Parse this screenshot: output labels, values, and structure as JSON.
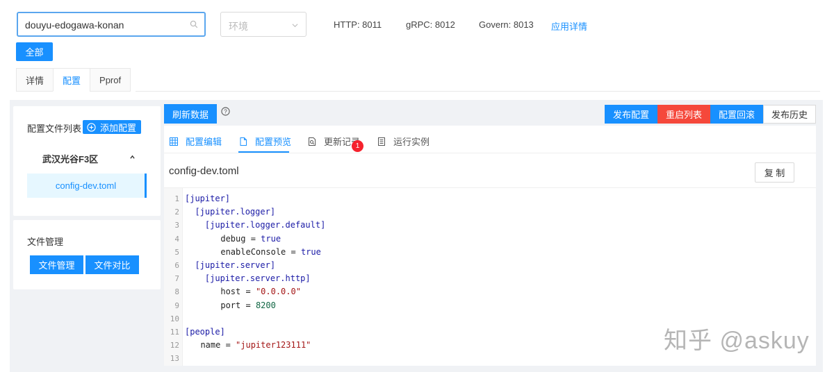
{
  "search": {
    "value": "douyu-edogawa-konan"
  },
  "env_select": {
    "placeholder": "环境"
  },
  "ports": {
    "http": "HTTP: 8011",
    "grpc": "gRPC: 8012",
    "govern": "Govern: 8013"
  },
  "app_detail_link": "应用详情",
  "all_button": "全部",
  "main_tabs": [
    "详情",
    "配置",
    "Pprof"
  ],
  "left_panel": {
    "title": "配置文件列表",
    "add_button": "添加配置",
    "group": "武汉光谷F3区",
    "file": "config-dev.toml"
  },
  "file_panel": {
    "title": "文件管理",
    "manage_button": "文件管理",
    "compare_button": "文件对比"
  },
  "toolbar": {
    "refresh": "刷新数据",
    "publish": "发布配置",
    "restart": "重启列表",
    "rollback": "配置回滚",
    "history": "发布历史",
    "colors": {
      "primary": "#1890ff",
      "danger": "#f5483b"
    }
  },
  "sub_tabs": [
    "配置编辑",
    "配置预览",
    "更新记录",
    "运行实例"
  ],
  "update_badge": "1",
  "editor": {
    "filename": "config-dev.toml",
    "copy_button": "复 制",
    "lines": [
      {
        "n": "1",
        "indent": "",
        "parts": [
          [
            "sec",
            "[jupiter]"
          ]
        ]
      },
      {
        "n": "2",
        "indent": "  ",
        "parts": [
          [
            "sec",
            "[jupiter.logger]"
          ]
        ]
      },
      {
        "n": "3",
        "indent": "    ",
        "parts": [
          [
            "sec",
            "[jupiter.logger.default]"
          ]
        ]
      },
      {
        "n": "4",
        "indent": "      ",
        "parts": [
          [
            "txt",
            "debug = "
          ],
          [
            "kw",
            "true"
          ]
        ]
      },
      {
        "n": "5",
        "indent": "      ",
        "parts": [
          [
            "txt",
            "enableConsole = "
          ],
          [
            "kw",
            "true"
          ]
        ]
      },
      {
        "n": "6",
        "indent": "  ",
        "parts": [
          [
            "sec",
            "[jupiter.server]"
          ]
        ]
      },
      {
        "n": "7",
        "indent": "    ",
        "parts": [
          [
            "sec",
            "[jupiter.server.http]"
          ]
        ]
      },
      {
        "n": "8",
        "indent": "      ",
        "parts": [
          [
            "txt",
            "host = "
          ],
          [
            "str",
            "\"0.0.0.0\""
          ]
        ]
      },
      {
        "n": "9",
        "indent": "      ",
        "parts": [
          [
            "txt",
            "port = "
          ],
          [
            "num",
            "8200"
          ]
        ]
      },
      {
        "n": "10",
        "indent": "",
        "parts": []
      },
      {
        "n": "11",
        "indent": "",
        "parts": [
          [
            "sec",
            "[people]"
          ]
        ]
      },
      {
        "n": "12",
        "indent": "  ",
        "parts": [
          [
            "txt",
            "name = "
          ],
          [
            "str",
            "\"jupiter123111\""
          ]
        ]
      },
      {
        "n": "13",
        "indent": "",
        "parts": []
      }
    ]
  },
  "watermark": "知乎 @askuy"
}
